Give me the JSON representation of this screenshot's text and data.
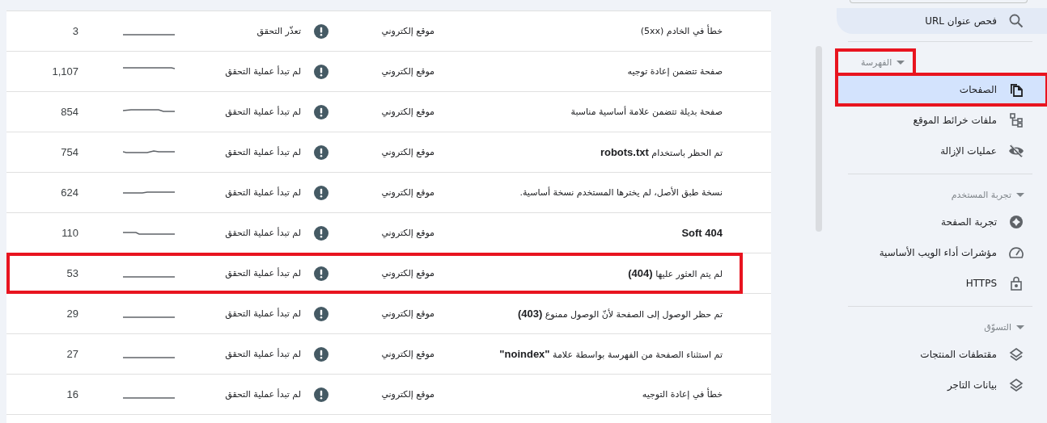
{
  "table": {
    "rows": [
      {
        "reason": "خطأ في الخادم (5xx)",
        "type": "موقع إلكتروني",
        "status": "تعذّر التحقق",
        "count": "3",
        "annotated": false
      },
      {
        "reason": "صفحة تتضمن إعادة توجيه",
        "type": "موقع إلكتروني",
        "status": "لم تبدأ عملية التحقق",
        "count": "1,107",
        "annotated": false
      },
      {
        "reason": "صفحة بديلة تتضمن علامة أساسية مناسبة",
        "type": "موقع إلكتروني",
        "status": "لم تبدأ عملية التحقق",
        "count": "854",
        "annotated": false
      },
      {
        "reason": "تم الحظر باستخدام **robots.txt**",
        "type": "موقع إلكتروني",
        "status": "لم تبدأ عملية التحقق",
        "count": "754",
        "annotated": false
      },
      {
        "reason": "نسخة طبق الأصل، لم يخترها المستخدم نسخة أساسية.",
        "type": "موقع إلكتروني",
        "status": "لم تبدأ عملية التحقق",
        "count": "624",
        "annotated": false
      },
      {
        "reason": "**Soft 404**",
        "type": "موقع إلكتروني",
        "status": "لم تبدأ عملية التحقق",
        "count": "110",
        "annotated": false
      },
      {
        "reason": "لم يتم العثور عليها **(404)**",
        "type": "موقع إلكتروني",
        "status": "لم تبدأ عملية التحقق",
        "count": "53",
        "annotated": true
      },
      {
        "reason": "تم حظر الوصول إلى الصفحة لأنّ الوصول ممنوع **(403)**",
        "type": "موقع إلكتروني",
        "status": "لم تبدأ عملية التحقق",
        "count": "29",
        "annotated": false
      },
      {
        "reason": "تم استثناء الصفحة من الفهرسة بواسطة علامة **\"noindex\"**",
        "type": "موقع إلكتروني",
        "status": "لم تبدأ عملية التحقق",
        "count": "27",
        "annotated": false
      },
      {
        "reason": "خطأ في إعادة التوجيه",
        "type": "موقع إلكتروني",
        "status": "لم تبدأ عملية التحقق",
        "count": "16",
        "annotated": false
      }
    ]
  },
  "sidebar": {
    "items": [
      {
        "kind": "link",
        "label": "فحص عنوان URL",
        "highlighted": true,
        "selected": false
      },
      {
        "kind": "section",
        "label": "الفهرسة",
        "expanded": true,
        "annotated": true,
        "children": [
          {
            "kind": "link",
            "label": "الصفحات",
            "selected": true,
            "annotated": true
          },
          {
            "kind": "link",
            "label": "ملفات خرائط الموقع",
            "selected": false,
            "annotated": false
          },
          {
            "kind": "link",
            "label": "عمليات الإزالة",
            "selected": false,
            "annotated": false
          }
        ]
      },
      {
        "kind": "section",
        "label": "تجربة المستخدم",
        "expanded": true,
        "annotated": false,
        "children": [
          {
            "kind": "link",
            "label": "تجربة الصفحة",
            "selected": false,
            "annotated": false
          },
          {
            "kind": "link",
            "label": "مؤشرات أداء الويب الأساسية",
            "selected": false,
            "annotated": false
          },
          {
            "kind": "link",
            "label": "HTTPS",
            "selected": false,
            "annotated": false
          }
        ]
      },
      {
        "kind": "section",
        "label": "التسوّق",
        "expanded": true,
        "annotated": false,
        "children": [
          {
            "kind": "link",
            "label": "مقتطفات المنتجات",
            "selected": false,
            "annotated": false
          },
          {
            "kind": "link",
            "label": "بيانات التاجر",
            "selected": false,
            "annotated": false
          }
        ]
      }
    ]
  }
}
